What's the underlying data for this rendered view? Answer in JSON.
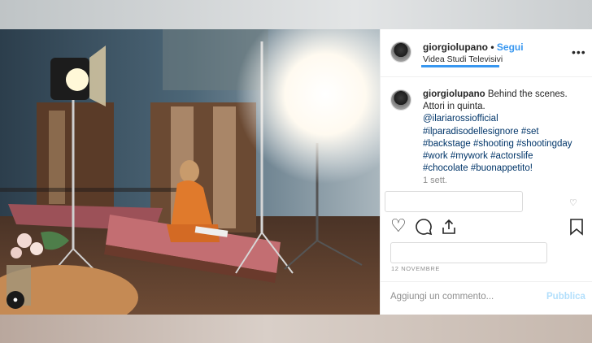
{
  "post": {
    "username": "giorgiolupano",
    "separator": "•",
    "follow_label": "Segui",
    "location": "Videa Studi Televisivi",
    "more": "•••",
    "caption_user": "giorgiolupano",
    "caption_lines": [
      "Behind the scenes.",
      "Attori in quinta."
    ],
    "tags": [
      "@ilariarossiofficial",
      "#ilparadisodellesignore #set",
      "#backstage #shooting #shootingday",
      "#work #mywork #actorslife",
      "#chocolate #buonappetito!"
    ],
    "time_ago": "1 sett.",
    "date": "12 NOVEMBRE",
    "comment_placeholder": "Aggiungi un commento...",
    "publish_label": "Pubblica"
  },
  "icons": {
    "like": "heart-icon",
    "comment": "comment-icon",
    "share": "share-icon",
    "save": "bookmark-icon",
    "user_tag": "user-tag-icon"
  },
  "colors": {
    "accent": "#3897f0",
    "publish_disabled": "#b2dffc",
    "text": "#262626",
    "muted": "#8e8e8e"
  }
}
